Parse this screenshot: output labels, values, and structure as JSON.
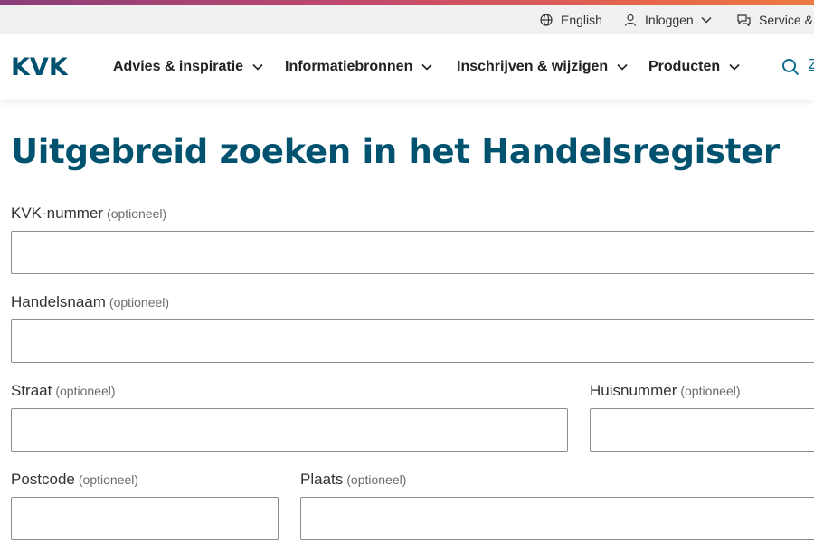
{
  "utility": {
    "language": "English",
    "login": "Inloggen",
    "service": "Service & "
  },
  "nav": {
    "logo": "KVK",
    "items": [
      "Advies & inspiratie",
      "Informatiebronnen",
      "Inschrijven & wijzigen",
      "Producten"
    ],
    "search_label": "Z"
  },
  "page": {
    "title": "Uitgebreid zoeken in het Handelsregister"
  },
  "form": {
    "optional": "(optioneel)",
    "kvk_label": "KVK-nummer",
    "handelsnaam_label": "Handelsnaam",
    "straat_label": "Straat",
    "huisnummer_label": "Huisnummer",
    "postcode_label": "Postcode",
    "plaats_label": "Plaats",
    "kvk_value": "",
    "handelsnaam_value": "",
    "straat_value": "",
    "huisnummer_value": "",
    "postcode_value": "",
    "plaats_value": ""
  },
  "colors": {
    "brand": "#00526e",
    "accent_gradient": [
      "#8a3e7a",
      "#c2496c",
      "#e7664c",
      "#ec7a3e"
    ]
  },
  "icons": [
    "globe-icon",
    "user-icon",
    "chat-icon",
    "chevron-down-icon",
    "search-icon"
  ]
}
